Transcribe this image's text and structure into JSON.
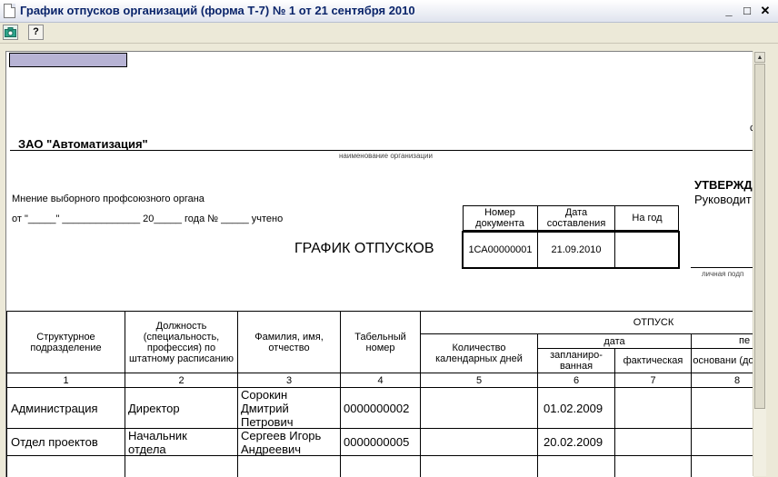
{
  "window": {
    "title": "График отпусков организаций (форма Т-7) № 1 от 21 сентября 2010",
    "minimize": "_",
    "maximize": "□",
    "close": "✕"
  },
  "toolbar": {
    "help_label": "?"
  },
  "icons": {
    "camera": "camera-icon",
    "help": "help-icon",
    "document": "document-icon"
  },
  "form": {
    "organization": "ЗАО \"Автоматизация\"",
    "organization_caption": "наименование организации",
    "union_opinion": "Мнение выборного профсоюзного органа",
    "union_date_line": "от \"_____\" ______________ 20_____ года № _____ учтено",
    "approve_label": "УТВЕРЖД",
    "head_label": "Руководит",
    "signature_caption": "личная подп",
    "right_edge_mark": "с",
    "doc_title": "ГРАФИК ОТПУСКОВ",
    "doc_table": {
      "headers": [
        "Номер документа",
        "Дата составления",
        "На год"
      ],
      "number": "1СА00000001",
      "date": "21.09.2010",
      "year": ""
    }
  },
  "table": {
    "headers": {
      "unit": "Структурное подразделение",
      "position": "Должность (специальность, профессия) по штатному расписанию",
      "name": "Фамилия, имя, отчество",
      "tab_number": "Табельный номер",
      "vacation": "ОТПУСК",
      "days": "Количество календарных дней",
      "date": "дата",
      "planned": "запланиро-ванная",
      "actual": "фактическая",
      "reason_top": "пе",
      "reason": "основани (докумен"
    },
    "column_numbers": [
      "1",
      "2",
      "3",
      "4",
      "5",
      "6",
      "7",
      "8"
    ],
    "rows": [
      {
        "unit": "Администрация",
        "position": "Директор",
        "name": "Сорокин Дмитрий Петрович",
        "tab_number": "0000000002",
        "days": "",
        "planned": "01.02.2009",
        "actual": "",
        "reason": ""
      },
      {
        "unit": "Отдел проектов",
        "position": "Начальник отдела",
        "name": "Сергеев Игорь Андреевич",
        "tab_number": "0000000005",
        "days": "",
        "planned": "20.02.2009",
        "actual": "",
        "reason": ""
      }
    ]
  }
}
